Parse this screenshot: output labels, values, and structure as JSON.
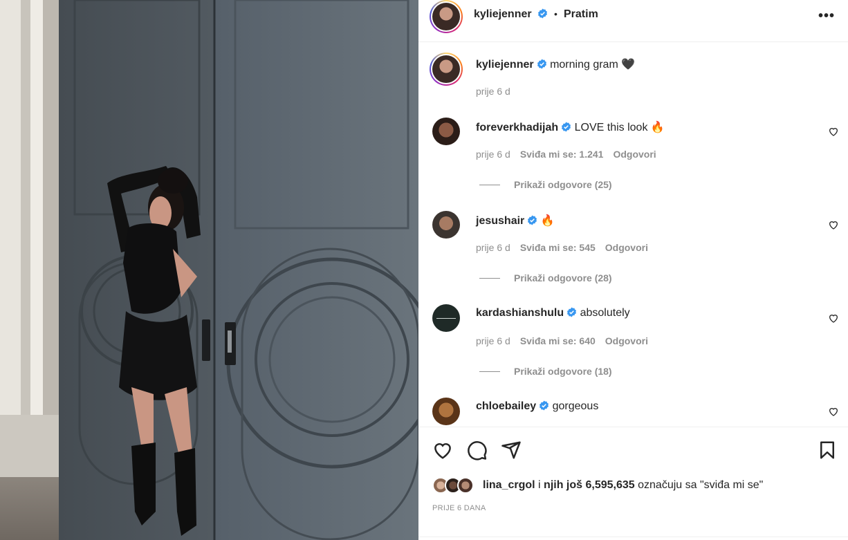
{
  "photo": {
    "alt_icon": "post-photo"
  },
  "header": {
    "username": "kyliejenner",
    "separator": "•",
    "follow_label": "Pratim",
    "more_label": "•••"
  },
  "caption": {
    "username": "kyliejenner",
    "text": "morning gram",
    "emoji": "🖤",
    "time": "prije 6 d"
  },
  "comments": [
    {
      "username": "foreverkhadijah",
      "text": "LOVE this look",
      "emoji": "🔥",
      "time": "prije 6 d",
      "likes": "Sviđa mi se: 1.241",
      "reply_label": "Odgovori",
      "replies": "Prikaži odgovore (25)"
    },
    {
      "username": "jesushair",
      "text": "",
      "emoji": "🔥",
      "time": "prije 6 d",
      "likes": "Sviđa mi se: 545",
      "reply_label": "Odgovori",
      "replies": "Prikaži odgovore (28)"
    },
    {
      "username": "kardashianshulu",
      "text": "absolutely",
      "emoji": "",
      "time": "prije 6 d",
      "likes": "Sviđa mi se: 640",
      "reply_label": "Odgovori",
      "replies": "Prikaži odgovore (18)"
    },
    {
      "username": "chloebailey",
      "text": "gorgeous",
      "emoji": "",
      "time": "",
      "likes": "",
      "reply_label": "",
      "replies": ""
    }
  ],
  "likes": {
    "first_user": "lina_crgol",
    "middle": "i",
    "others": "njih još 6,595,635",
    "suffix": "označuju sa \"sviđa mi se\""
  },
  "post_date": "PRIJE 6 DANA",
  "colors": {
    "verified": "#3897f0",
    "text": "#262626",
    "muted": "#8e8e8e",
    "border": "#efefef"
  },
  "icons": [
    "heart-icon",
    "comment-icon",
    "share-icon",
    "bookmark-icon",
    "more-icon",
    "verified-icon"
  ]
}
